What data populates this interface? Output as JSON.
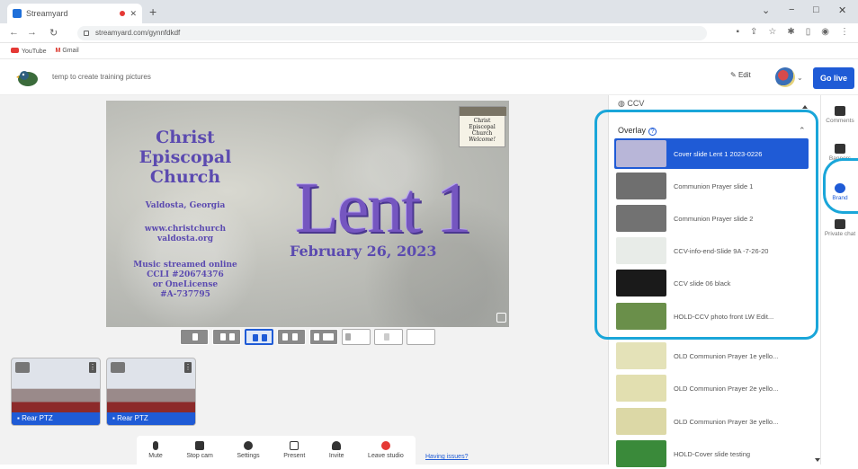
{
  "browser": {
    "tab_title": "Streamyard",
    "new_tab": "+",
    "url": "streamyard.com/gynnfdkdf",
    "window_controls": [
      "⌄",
      "−",
      "□",
      "✕"
    ],
    "bookmarks": [
      {
        "label": "YouTube",
        "icon": "youtube-icon"
      },
      {
        "label": "Gmail",
        "icon": "gmail-icon"
      }
    ]
  },
  "header": {
    "studio_title": "temp to create training pictures",
    "edit_label": "Edit",
    "go_live_label": "Go live"
  },
  "slide": {
    "church_name": "Christ Episcopal Church",
    "location": "Valdosta, Georgia",
    "website": "www.christchurch valdosta.org",
    "music_line1": "Music streamed online",
    "music_line2": "CCLI #20674376",
    "music_line3": "or OneLicense",
    "music_line4": "#A-737795",
    "big_title": "Lent 1",
    "date": "February 26, 2023",
    "badge_line1": "Christ",
    "badge_line2": "Episcopal",
    "badge_line3": "Church",
    "badge_line4": "Welcome!"
  },
  "cameras": [
    {
      "label": "Rear PTZ"
    },
    {
      "label": "Rear PTZ"
    }
  ],
  "toolbar": {
    "mute": "Mute",
    "stop_cam": "Stop cam",
    "settings": "Settings",
    "present": "Present",
    "invite": "Invite",
    "leave": "Leave studio"
  },
  "help_link": "Having issues?",
  "panel": {
    "header_label": "CCV",
    "overlay_title": "Overlay",
    "items": [
      {
        "label": "Cover slide Lent 1 2023-0226",
        "selected": true,
        "thumb_color": "#b8b6d8"
      },
      {
        "label": "Communion Prayer slide 1",
        "selected": false,
        "thumb_color": "#6f6f6f"
      },
      {
        "label": "Communion Prayer slide 2",
        "selected": false,
        "thumb_color": "#727272"
      },
      {
        "label": "CCV-info-end-Slide 9A -7-26-20",
        "selected": false,
        "thumb_color": "#e8ece8"
      },
      {
        "label": "CCV slide 06 black",
        "selected": false,
        "thumb_color": "#1a1a1a"
      },
      {
        "label": "HOLD-CCV photo front LW Edit...",
        "selected": false,
        "thumb_color": "#6a8f4a"
      },
      {
        "label": "OLD Communion Prayer 1e yello...",
        "selected": false,
        "thumb_color": "#e4e2b8"
      },
      {
        "label": "OLD Communion Prayer 2e yello...",
        "selected": false,
        "thumb_color": "#e2dfb0"
      },
      {
        "label": "OLD Communion Prayer 3e yello...",
        "selected": false,
        "thumb_color": "#dcd8a6"
      },
      {
        "label": "HOLD-Cover slide testing",
        "selected": false,
        "thumb_color": "#3a8a3a"
      }
    ]
  },
  "rail": {
    "comments": "Comments",
    "banners": "Banners",
    "brand": "Brand",
    "private_chat": "Private chat"
  },
  "colors": {
    "accent": "#1f5bd6",
    "highlight_ring": "#1aa6d9",
    "slide_text": "#5b4ab0"
  }
}
